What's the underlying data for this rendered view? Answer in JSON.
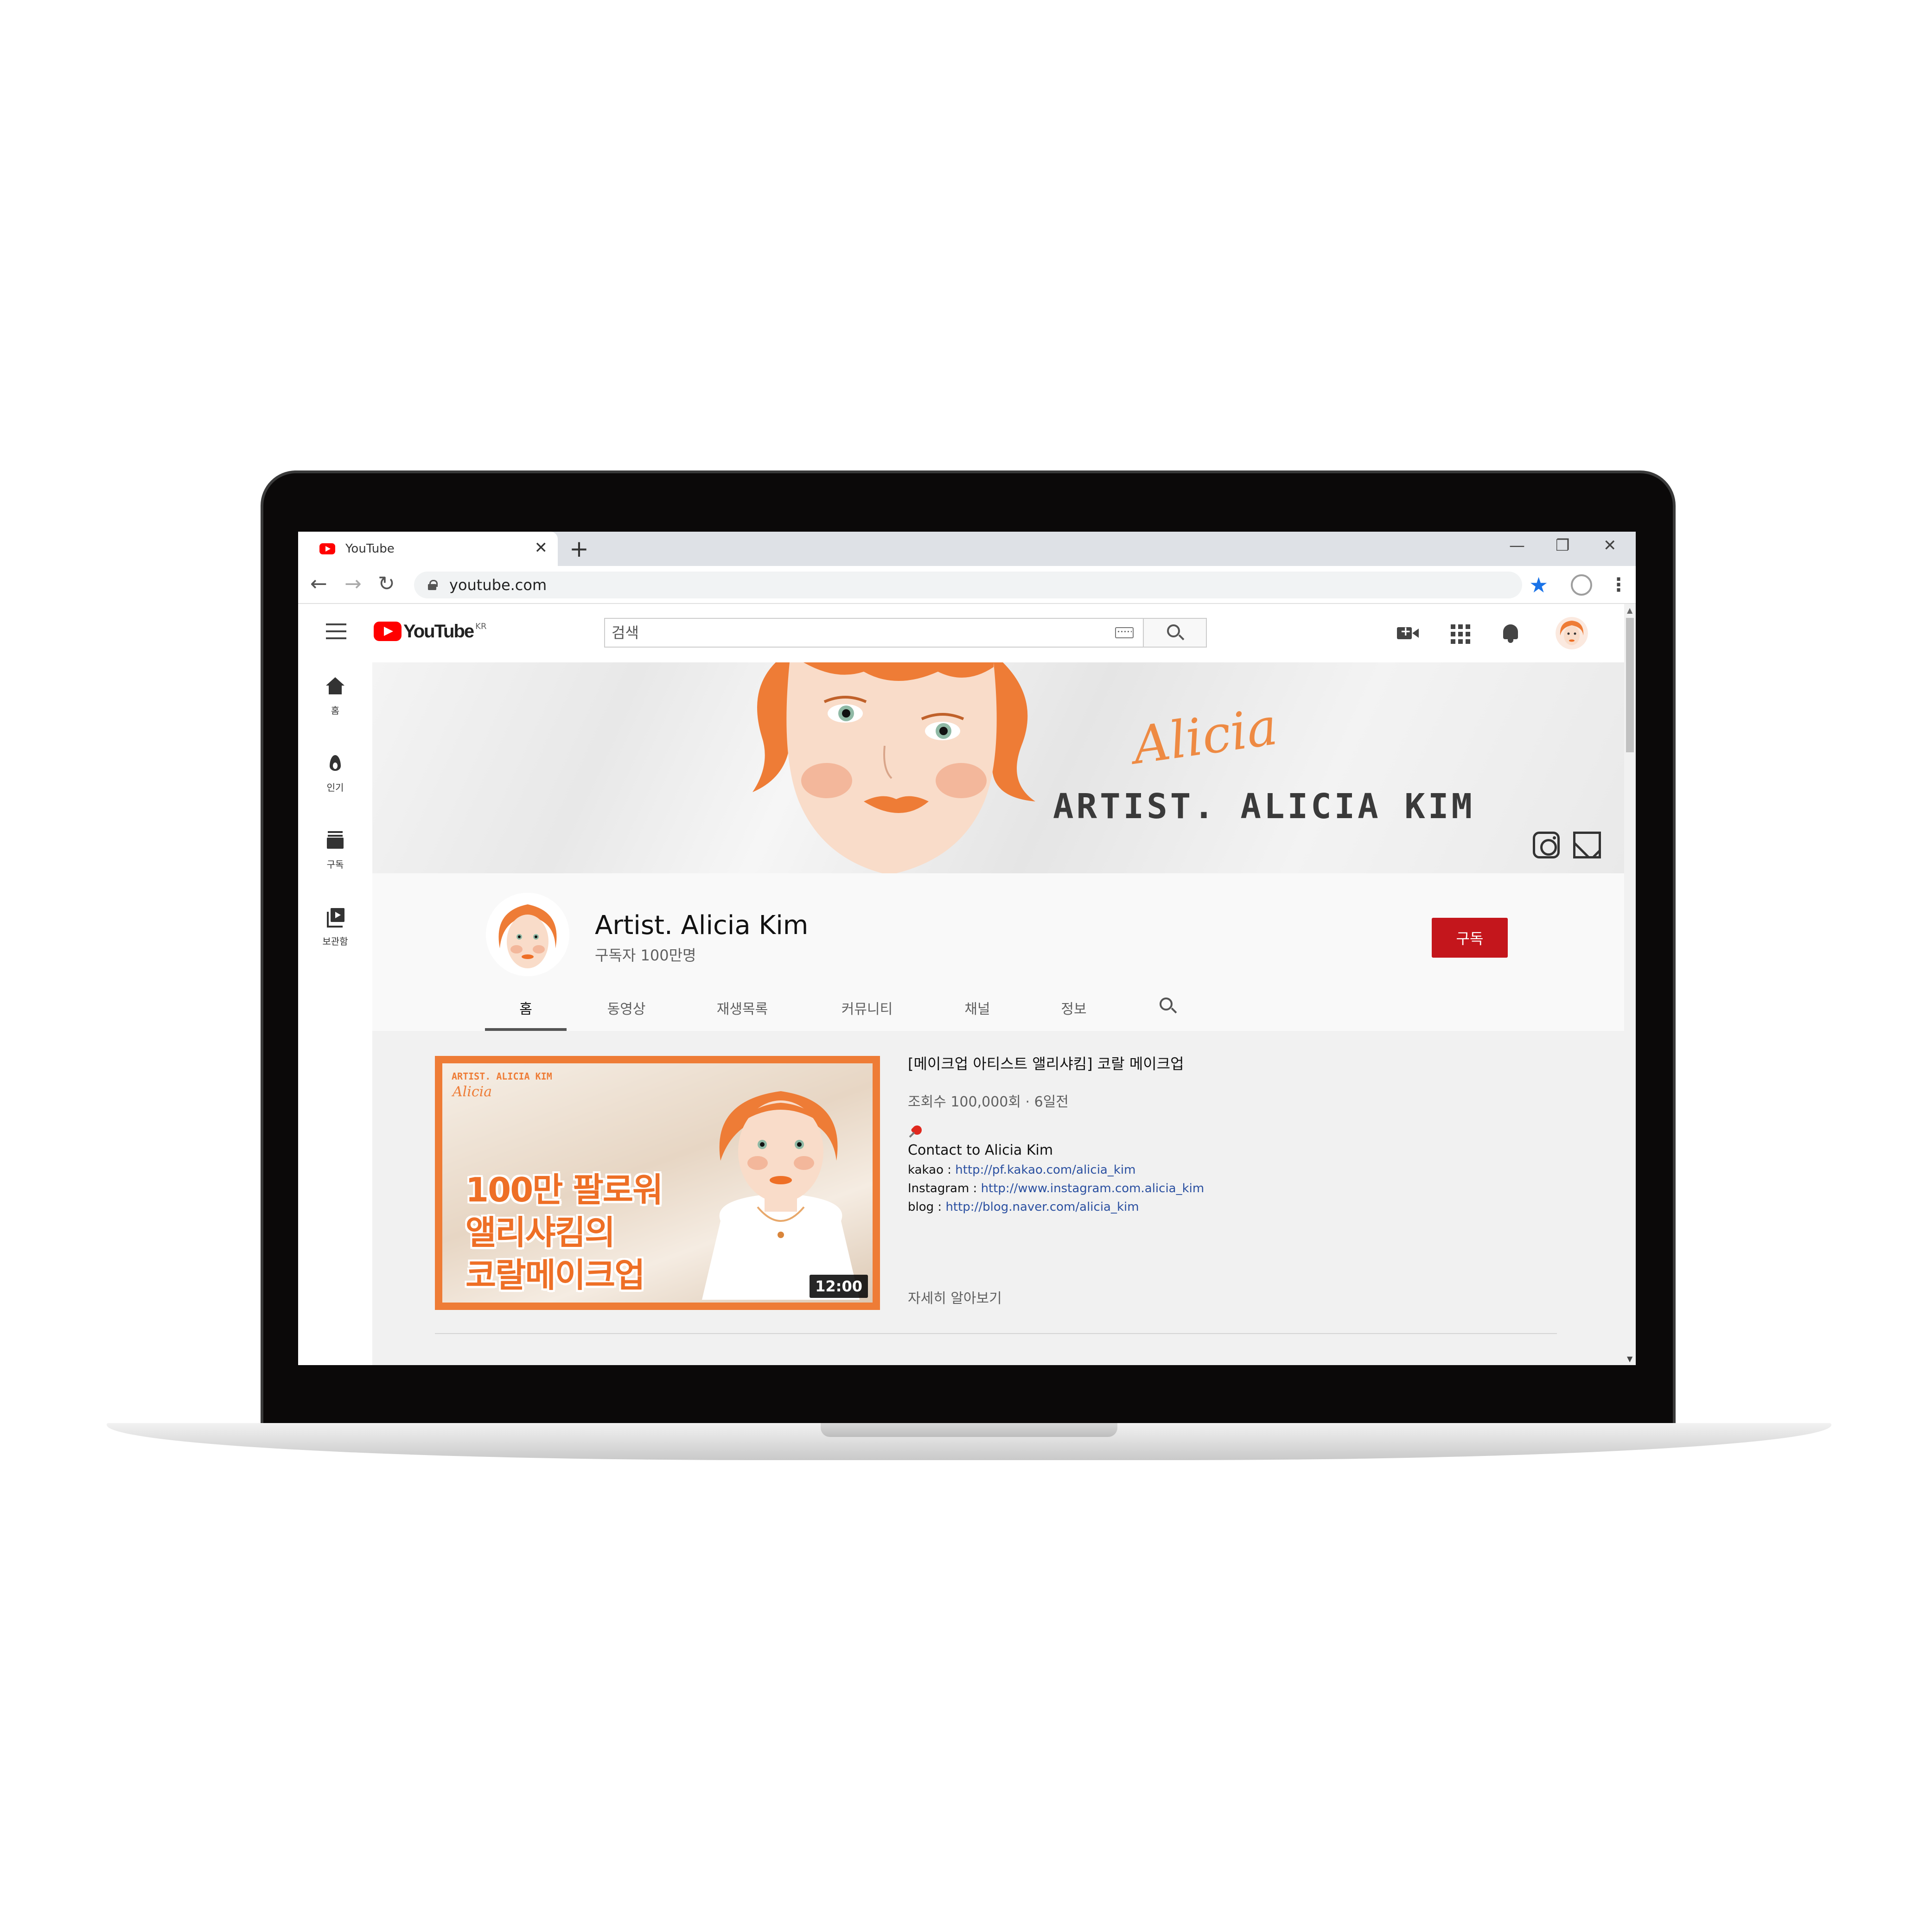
{
  "browser": {
    "tab_title": "YouTube",
    "tab_close": "✕",
    "new_tab": "+",
    "window_controls": [
      "—",
      "❐",
      "✕"
    ],
    "url": "youtube.com",
    "nav": [
      "←",
      "→",
      "↻"
    ],
    "bookmark_star": "★",
    "menu": "⋮"
  },
  "youtube": {
    "logo_text": "YouTube",
    "region": "KR",
    "search_placeholder": "검색",
    "guide": [
      {
        "label": "홈",
        "icon": "home-icon"
      },
      {
        "label": "인기",
        "icon": "trending-icon"
      },
      {
        "label": "구독",
        "icon": "subscriptions-icon"
      },
      {
        "label": "보관함",
        "icon": "library-icon"
      }
    ]
  },
  "banner": {
    "script": "Alicia",
    "title": "ARTIST. ALICIA KIM"
  },
  "channel": {
    "name": "Artist. Alicia Kim",
    "subscribers": "구독자 100만명",
    "subscribe_label": "구독",
    "tabs": [
      "홈",
      "동영상",
      "재생목록",
      "커뮤니티",
      "채널",
      "정보"
    ],
    "active_tab": "홈"
  },
  "featured_video": {
    "thumbnail": {
      "brand": "ARTIST. ALICIA KIM",
      "script": "Alicia",
      "lines": [
        "100만 팔로워",
        "앨리샤킴의",
        "코랄메이크업"
      ]
    },
    "duration": "12:00",
    "title": "[메이크업 아티스트 앨리샤킴] 코랄 메이크업",
    "meta": "조회수 100,000회 · 6일전",
    "contact_heading": "Contact to Alicia Kim",
    "links": [
      {
        "label": "kakao : ",
        "url": "http://pf.kakao.com/alicia_kim"
      },
      {
        "label": "Instagram : ",
        "url": "http://www.instagram.com.alicia_kim"
      },
      {
        "label": "blog : ",
        "url": "http://blog.naver.com/alicia_kim"
      }
    ],
    "more": "자세히 알아보기"
  },
  "colors": {
    "accent": "#ee7c36",
    "subscribe": "#c4161c",
    "link": "#2a4fa0",
    "youtube_red": "#ff0000"
  }
}
